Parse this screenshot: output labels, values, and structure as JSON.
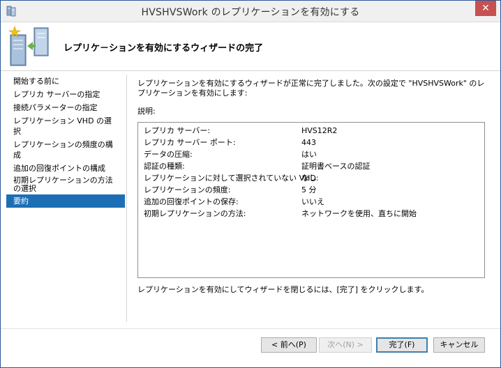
{
  "window": {
    "title": "HVSHVSWork のレプリケーションを有効にする",
    "close_glyph": "✕"
  },
  "header": {
    "title": "レプリケ－ションを有効にするウィザードの完了"
  },
  "nav": {
    "items": [
      {
        "label": "開始する前に"
      },
      {
        "label": "レプリカ サーバーの指定"
      },
      {
        "label": "接続パラメーターの指定"
      },
      {
        "label": "レプリケーション VHD の選択"
      },
      {
        "label": "レプリケーションの頻度の構成"
      },
      {
        "label": "追加の回復ポイントの構成"
      },
      {
        "label": "初期レプリケーションの方法の選択"
      },
      {
        "label": "要約"
      }
    ],
    "selected_index": 7
  },
  "content": {
    "intro": "レプリケーションを有効にするウィザードが正常に完了しました。次の設定で \"HVSHVSWork\" のレプリケーションを有効にします:",
    "description_label": "説明:",
    "summary": [
      {
        "key": "レプリカ サーバー:",
        "value": "HVS12R2"
      },
      {
        "key": "レプリカ サーバー ポート:",
        "value": "443"
      },
      {
        "key": "データの圧縮:",
        "value": "はい"
      },
      {
        "key": "認証の種類:",
        "value": "証明書ベースの認証"
      },
      {
        "key": "レプリケーションに対して選択されていない VHD:",
        "value": "なし"
      },
      {
        "key": "レプリケーションの頻度:",
        "value": "5 分"
      },
      {
        "key": "追加の回復ポイントの保存:",
        "value": "いいえ"
      },
      {
        "key": "初期レプリケーションの方法:",
        "value": "ネットワークを使用、直ちに開始"
      }
    ],
    "finish_note": "レプリケーションを有効にしてウィザードを閉じるには、[完了] をクリックします。"
  },
  "buttons": {
    "prev": "< 前へ(P)",
    "next": "次へ(N) >",
    "finish": "完了(F)",
    "cancel": "キャンセル"
  },
  "colors": {
    "selection": "#1c6fb5",
    "close_button": "#c75050",
    "window_border": "#2b5797"
  }
}
